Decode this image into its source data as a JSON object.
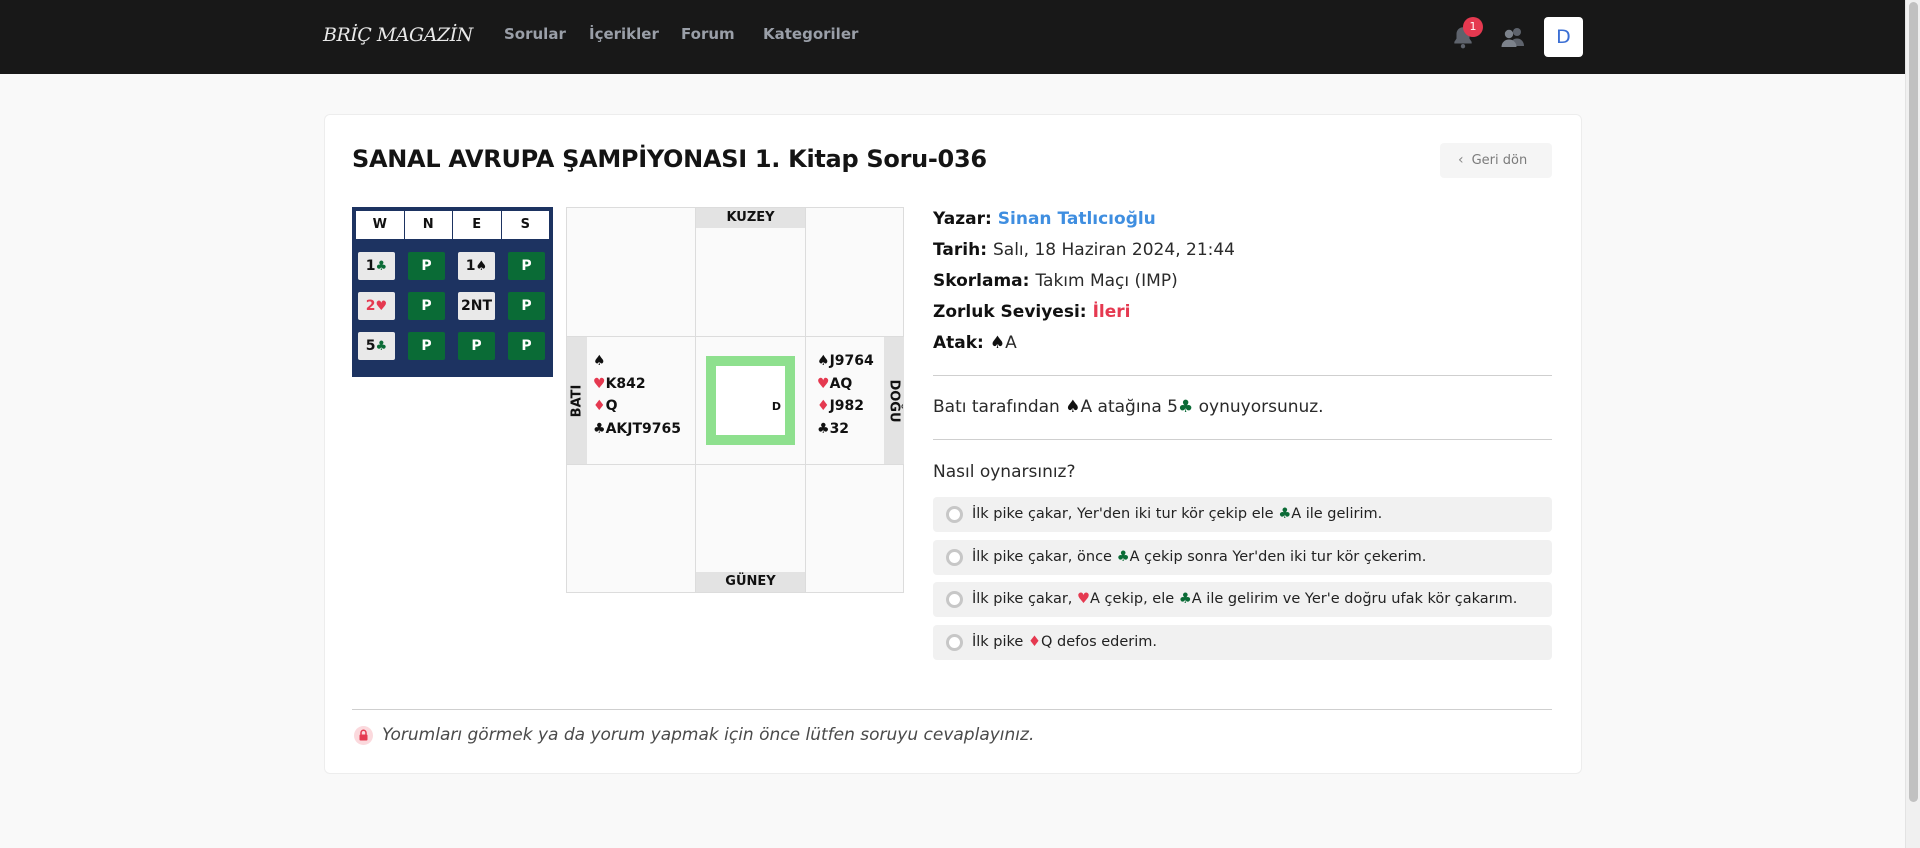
{
  "header": {
    "logo": "BRİÇ MAGAZİN",
    "nav": [
      "Sorular",
      "İçerikler",
      "Forum",
      "Kategoriler"
    ],
    "notification_count": "1",
    "avatar_letter": "D"
  },
  "page": {
    "title": "SANAL AVRUPA ŞAMPİYONASI 1. Kitap Soru-036",
    "back_label": "Geri dön"
  },
  "bidding": {
    "headers": [
      "W",
      "N",
      "E",
      "S"
    ],
    "rows": [
      [
        {
          "level": "1",
          "suit": "♣",
          "suit_class": "suit-c",
          "style": "light"
        },
        {
          "level": "P",
          "suit": "",
          "suit_class": "",
          "style": "green"
        },
        {
          "level": "1",
          "suit": "♠",
          "suit_class": "suit-s",
          "style": "light"
        },
        {
          "level": "P",
          "suit": "",
          "suit_class": "",
          "style": "green"
        }
      ],
      [
        {
          "level": "2",
          "suit": "♥",
          "suit_class": "suit-h",
          "style": "light"
        },
        {
          "level": "P",
          "suit": "",
          "suit_class": "",
          "style": "green"
        },
        {
          "level": "2NT",
          "suit": "",
          "suit_class": "",
          "style": "light"
        },
        {
          "level": "P",
          "suit": "",
          "suit_class": "",
          "style": "green"
        }
      ],
      [
        {
          "level": "5",
          "suit": "♣",
          "suit_class": "suit-c",
          "style": "light"
        },
        {
          "level": "P",
          "suit": "",
          "suit_class": "",
          "style": "green"
        },
        {
          "level": "P",
          "suit": "",
          "suit_class": "",
          "style": "green"
        },
        {
          "level": "P",
          "suit": "",
          "suit_class": "",
          "style": "green"
        }
      ]
    ]
  },
  "deal": {
    "north_label": "KUZEY",
    "south_label": "GÜNEY",
    "west_label": "BATI",
    "east_label": "DOĞU",
    "dealer": "D",
    "west_hand": {
      "spades": "",
      "hearts": "K842",
      "diamonds": "Q",
      "clubs": "AKJT9765"
    },
    "east_hand": {
      "spades": "J9764",
      "hearts": "AQ",
      "diamonds": "J982",
      "clubs": "32"
    }
  },
  "info": {
    "author_label": "Yazar:",
    "author": "Sinan Tatlıcıoğlu",
    "date_label": "Tarih:",
    "date": "Salı, 18 Haziran 2024, 21:44",
    "scoring_label": "Skorlama:",
    "scoring": "Takım Maçı (IMP)",
    "difficulty_label": "Zorluk Seviyesi:",
    "difficulty": "İleri",
    "lead_label": "Atak:",
    "lead": "A"
  },
  "problem": {
    "before": "Batı tarafından ",
    "lead": "A",
    "middle": " atağına 5",
    "after": " oynuyorsunuz."
  },
  "question": "Nasıl oynarsınız?",
  "options": [
    {
      "a": "İlk pike çakar, Yer'den iki tur kör çekip ele ",
      "s1": "♣",
      "c1": "suit-c",
      "b": "A ile gelirim.",
      "s2": "",
      "c2": "",
      "c": ""
    },
    {
      "a": "İlk pike çakar, önce ",
      "s1": "♣",
      "c1": "suit-c",
      "b": "A çekip sonra Yer'den iki tur kör çekerim.",
      "s2": "",
      "c2": "",
      "c": ""
    },
    {
      "a": "İlk pike çakar, ",
      "s1": "♥",
      "c1": "suit-h",
      "b": "A çekip, ele ",
      "s2": "♣",
      "c2": "suit-c",
      "c": "A ile gelirim ve Yer'e doğru ufak kör çakarım."
    },
    {
      "a": "İlk pike ",
      "s1": "♦",
      "c1": "suit-d",
      "b": "Q defos ederim.",
      "s2": "",
      "c2": "",
      "c": ""
    }
  ],
  "comments_note": "Yorumları görmek ya da yorum yapmak için önce lütfen soruyu cevaplayınız.",
  "colors": {
    "brand_dark": "#181818",
    "author": "#3f8ee0",
    "difficulty": "#e53950",
    "bid_green": "#0a6b36",
    "bid_panel": "#1d3361",
    "table_green": "#8ee08e"
  }
}
